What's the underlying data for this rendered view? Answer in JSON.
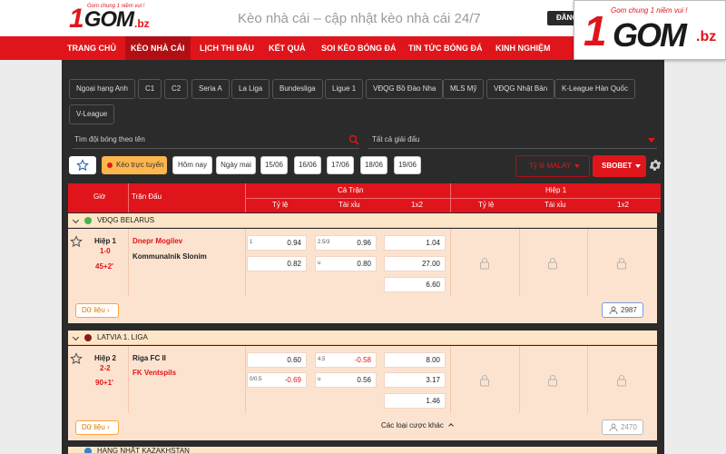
{
  "header": {
    "logo_number": "1",
    "logo_word": "GOM",
    "logo_tld": ".bz",
    "logo_slogan": "Gom chung 1 niềm vui !",
    "site_title": "Kèo nhà cái – cập nhật kèo nhà cái 24/7",
    "login_label": "ĐĂNG"
  },
  "overlay_logo": {
    "number": "1",
    "word": "GOM",
    "tld": ".bz",
    "slogan": "Gom chung 1 niềm vui !"
  },
  "nav": {
    "items": [
      {
        "label": "TRANG CHỦ"
      },
      {
        "label": "KÈO NHÀ CÁI",
        "active": true
      },
      {
        "label": "LỊCH THI ĐẤU"
      },
      {
        "label": "KẾT QUẢ"
      },
      {
        "label": "SOI KÈO BÓNG ĐÁ"
      },
      {
        "label": "TIN TỨC BÓNG ĐÁ"
      },
      {
        "label": "KINH NGHIỆM"
      }
    ]
  },
  "leagues": [
    "Ngoại hạng Anh",
    "C1",
    "C2",
    "Seria A",
    "La Liga",
    "Bundesliga",
    "Ligue 1",
    "VĐQG Bồ Đào Nha",
    "MLS Mỹ",
    "VĐQG Nhật Bản",
    "K-League Hàn Quốc",
    "V-League"
  ],
  "search": {
    "team_placeholder": "Tìm đội bóng theo tên",
    "league_filter": "Tất cả giải đấu"
  },
  "filters": {
    "live_label": "Kèo trực tuyến",
    "dates": [
      "Hôm nay",
      "Ngày mai",
      "15/06",
      "16/06",
      "17/06",
      "18/06",
      "19/06"
    ],
    "odds_type": "Tỷ lệ MALAY",
    "bookmaker": "SBOBET"
  },
  "table_header": {
    "time": "Giờ",
    "match": "Trận Đấu",
    "full_match": "Cả Trận",
    "first_half": "Hiệp 1",
    "handicap": "Tỷ lệ",
    "over_under": "Tài xỉu",
    "one_x_two": "1x2"
  },
  "groups": [
    {
      "league": "VĐQG BELARUS",
      "flag_color": "#4caf50",
      "match": {
        "period": "Hiệp 1",
        "score": "1-0",
        "minute": "45+2'",
        "home": "Dnepr Mogilev",
        "away": "Kommunalnik Slonim",
        "hdp": [
          {
            "line": "1",
            "value": "0.94"
          },
          {
            "line": "",
            "value": "0.82"
          }
        ],
        "ou": [
          {
            "line": "2.5/3",
            "value": "0.96"
          },
          {
            "line": "u",
            "value": "0.80"
          }
        ],
        "x12": [
          "1.04",
          "27.00",
          "6.60"
        ],
        "data_label": "Dữ liệu",
        "viewers": "2987"
      }
    },
    {
      "league": "LATVIA 1. LIGA",
      "flag_color": "#8b1a1a",
      "match": {
        "period": "Hiệp 2",
        "score": "2-2",
        "minute": "90+1'",
        "home": "Riga FC II",
        "away": "FK Ventspils",
        "hdp": [
          {
            "line": "",
            "value": "0.60"
          },
          {
            "line": "0/0.5",
            "value": "-0.69"
          }
        ],
        "ou": [
          {
            "line": "4.5",
            "value": "-0.58"
          },
          {
            "line": "u",
            "value": "0.56"
          }
        ],
        "x12": [
          "8.00",
          "3.17",
          "1.46"
        ],
        "data_label": "Dữ liệu",
        "viewers": "2470",
        "more_bets": "Các loại cược khác"
      }
    },
    {
      "league": "HẠNG NHẤT KAZAKHSTAN"
    }
  ],
  "colors": {
    "brand_red": "#e0151b",
    "row_bg": "#fce3cf",
    "league_bg": "#fde6c8",
    "content_bg": "#2b2b2b"
  }
}
